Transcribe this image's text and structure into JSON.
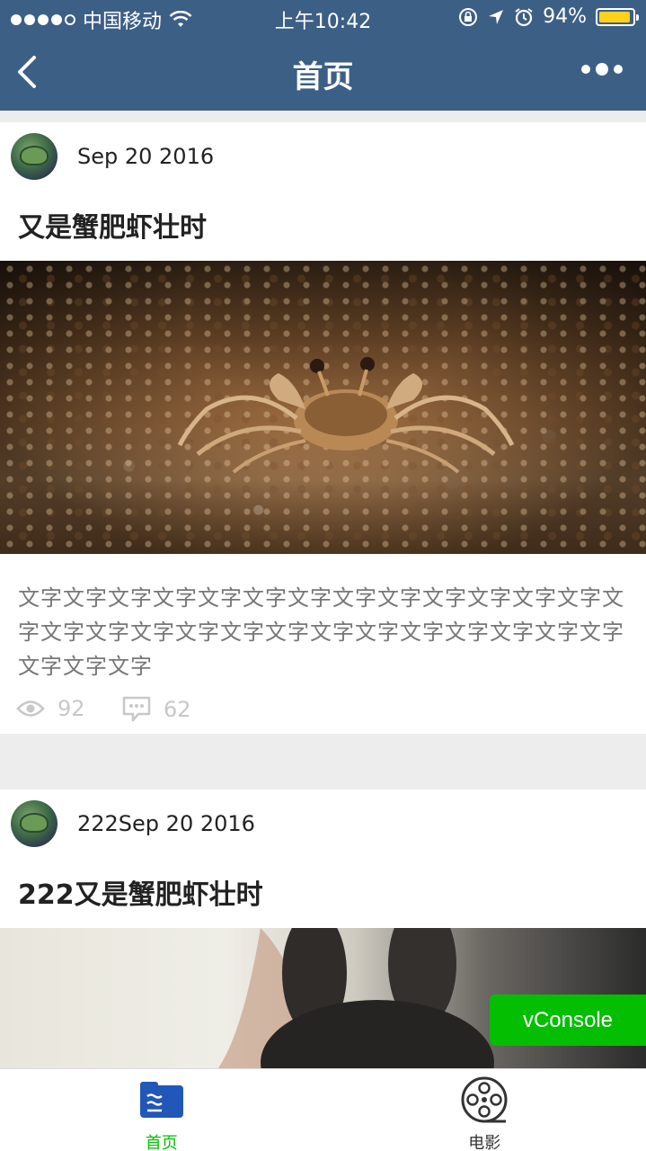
{
  "status_bar": {
    "carrier": "中国移动",
    "time": "上午10:42",
    "battery_percent": "94%",
    "battery_level": 0.94
  },
  "nav": {
    "title": "首页"
  },
  "posts": [
    {
      "date": "Sep 20 2016",
      "title": "又是蟹肥虾壮时",
      "text": "文字文字文字文字文字文字文字文字文字文字文字文字文字文字文字文字文字文字文字文字文字文字文字文字文字文字文字文字文字文字",
      "views": "92",
      "comments": "62",
      "image": "crab-photo"
    },
    {
      "date": "222Sep 20 2016",
      "title": "222又是蟹肥虾壮时",
      "image": "rabbit-photo"
    }
  ],
  "vconsole": {
    "label": "vConsole"
  },
  "tabbar": {
    "tabs": [
      {
        "label": "首页",
        "icon": "home-icon",
        "active": true
      },
      {
        "label": "电影",
        "icon": "film-reel-icon",
        "active": false
      }
    ]
  },
  "colors": {
    "navbar": "#3c5f86",
    "tab_active": "#04be02",
    "vconsole": "#04be02"
  }
}
